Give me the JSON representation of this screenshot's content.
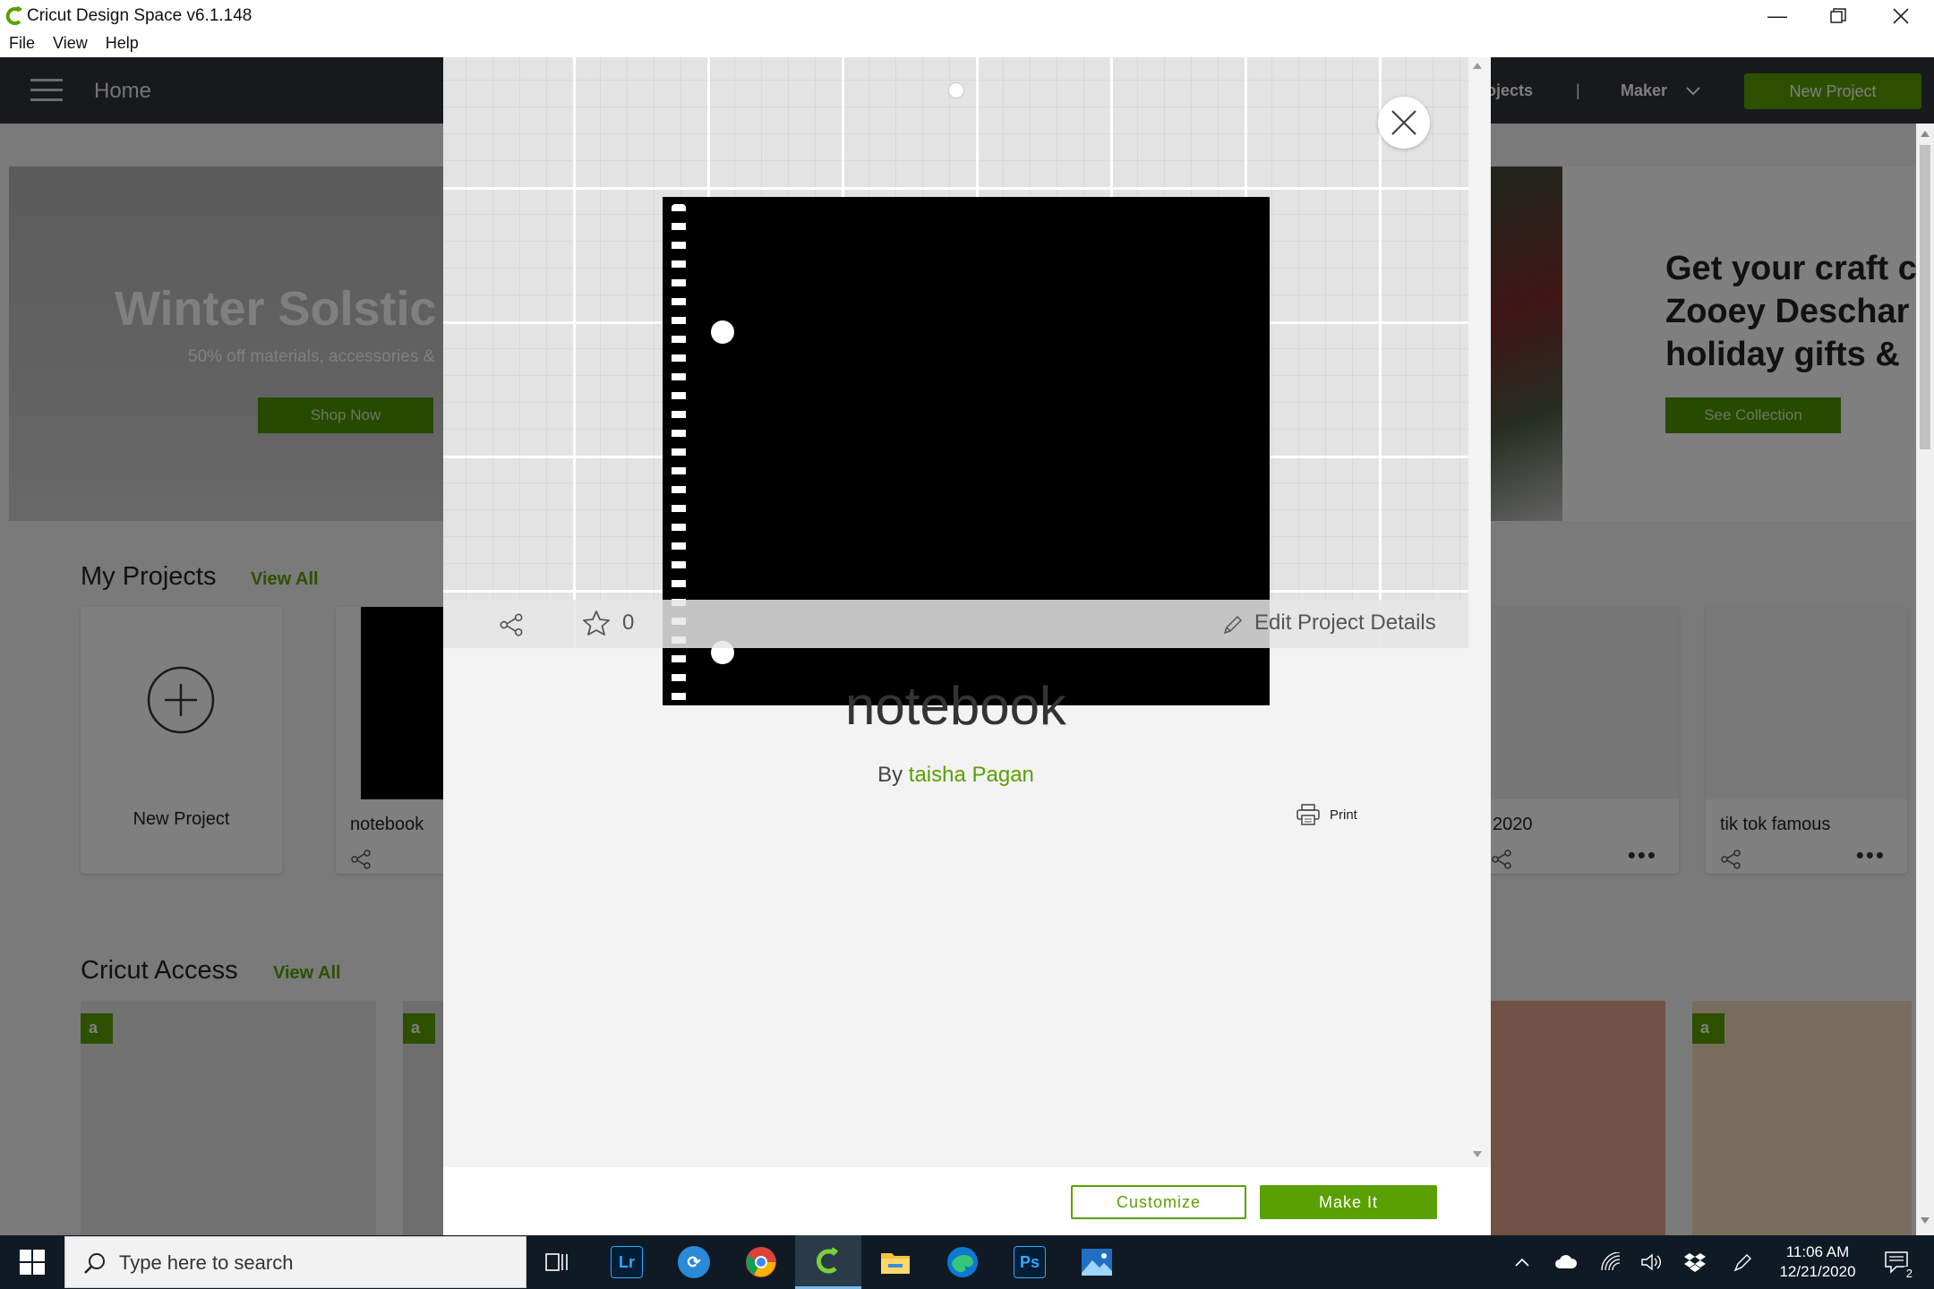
{
  "window": {
    "title": "Cricut Design Space  v6.1.148",
    "menu": [
      "File",
      "View",
      "Help"
    ]
  },
  "header": {
    "home_label": "Home",
    "projects_label": "ojects",
    "separator": "|",
    "maker_label": "Maker",
    "new_project_label": "New Project"
  },
  "background": {
    "hero_left": {
      "title": "Winter Solstic",
      "subtitle": "50% off materials, accessories &",
      "button": "Shop Now"
    },
    "hero_right": {
      "line1": "Get your craft c",
      "line2": "Zooey Deschar",
      "line3": "holiday gifts &",
      "button": "See Collection"
    },
    "my_projects": {
      "title": "My Projects",
      "view_all": "View All",
      "new_project_card": "New Project",
      "cards": [
        {
          "name": "notebook"
        },
        {
          "name": "2020"
        },
        {
          "name": "tik tok famous"
        }
      ]
    },
    "cricut_access": {
      "title": "Cricut Access",
      "view_all": "View All"
    }
  },
  "modal": {
    "project_title": "notebook",
    "by_label": "By",
    "author": "taisha Pagan",
    "favorites_count": "0",
    "edit_details_label": "Edit Project Details",
    "print_label": "Print",
    "customize_label": "Customize",
    "make_it_label": "Make It"
  },
  "taskbar": {
    "search_placeholder": "Type here to search",
    "time": "11:06 AM",
    "date": "12/21/2020",
    "notification_count": "2",
    "apps": [
      "task-view",
      "lightroom",
      "app-blue",
      "chrome",
      "cricut",
      "file-explorer",
      "edge",
      "photoshop",
      "photos"
    ]
  },
  "colors": {
    "accent_green": "#5aa000",
    "header_bg": "#2f3336",
    "taskbar_bg": "#0f1a24"
  }
}
